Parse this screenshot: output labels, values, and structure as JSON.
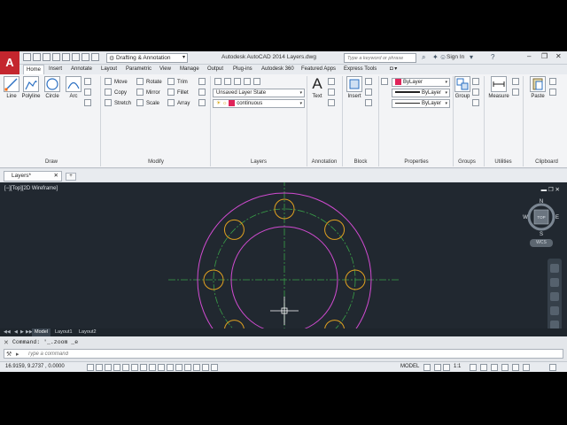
{
  "app": {
    "logo": "A",
    "workspace": "Drafting & Annotation",
    "window_title": "Autodesk AutoCAD 2014    Layers.dwg",
    "search_placeholder": "Type a keyword or phrase",
    "sign_in": "Sign In"
  },
  "ribbon_tabs": [
    "Home",
    "Insert",
    "Annotate",
    "Layout",
    "Parametric",
    "View",
    "Manage",
    "Output",
    "Plug-ins",
    "Autodesk 360",
    "Featured Apps",
    "Express Tools"
  ],
  "draw_panel": {
    "title": "Draw",
    "tools": [
      "Line",
      "Polyline",
      "Circle",
      "Arc"
    ]
  },
  "modify_panel": {
    "title": "Modify",
    "tools": [
      "Move",
      "Rotate",
      "Trim",
      "Copy",
      "Mirror",
      "Fillet",
      "Stretch",
      "Scale",
      "Array"
    ]
  },
  "layers_panel": {
    "title": "Layers",
    "layer_state": "Unsaved Layer State",
    "current_layer": "continuous"
  },
  "annotation_panel": {
    "title": "Annotation",
    "text_label": "Text"
  },
  "block_panel": {
    "title": "Block",
    "insert_label": "Insert"
  },
  "properties_panel": {
    "title": "Properties",
    "color": "ByLayer",
    "linetype": "ByLayer",
    "lineweight": "ByLayer"
  },
  "groups_panel": {
    "title": "Groups",
    "group_label": "Group"
  },
  "utilities_panel": {
    "title": "Utilities",
    "measure_label": "Measure"
  },
  "clipboard_panel": {
    "title": "Clipboard",
    "paste_label": "Paste"
  },
  "file_tab": "Layers*",
  "viewport_label": "[−][Top][2D Wireframe]",
  "viewcube": {
    "north": "N",
    "south": "S",
    "east": "E",
    "west": "W",
    "top": "TOP",
    "wcs": "WCS"
  },
  "ucs": {
    "x": "X",
    "y": "Y"
  },
  "layout_tabs": [
    "Model",
    "Layout1",
    "Layout2"
  ],
  "command": {
    "history": "Command: '_.zoom _e",
    "placeholder": "Type a command"
  },
  "status": {
    "coords": "16.9159, 9.2737 , 0.0000",
    "model": "MODEL",
    "scale": "1:1"
  },
  "colors": {
    "canvas_bg": "#212830",
    "circle_magenta": "#d14bd1",
    "hole_orange": "#e0a020",
    "centerline_green": "#3aa048",
    "layer_swatch": "#e0245a"
  }
}
